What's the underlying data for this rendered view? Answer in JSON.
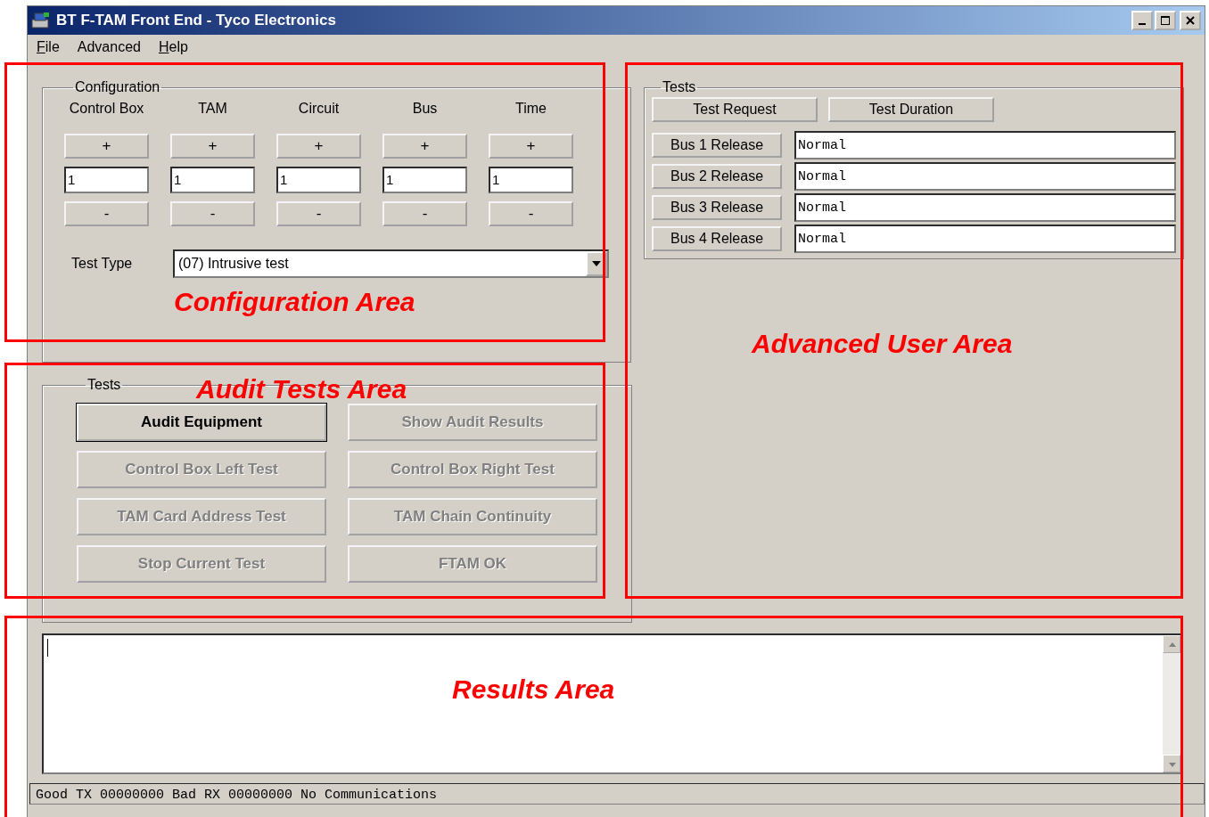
{
  "window": {
    "title": "BT F-TAM Front End - Tyco Electronics"
  },
  "menu": [
    {
      "label": "File",
      "underlined": true
    },
    {
      "label": "Advanced",
      "underlined": false
    },
    {
      "label": "Help",
      "underlined": true
    }
  ],
  "configuration": {
    "title": "Configuration",
    "columns": [
      {
        "label": "Control Box",
        "increment": "+",
        "value": "1",
        "decrement": "-"
      },
      {
        "label": "TAM",
        "increment": "+",
        "value": "1",
        "decrement": "-"
      },
      {
        "label": "Circuit",
        "increment": "+",
        "value": "1",
        "decrement": "-"
      },
      {
        "label": "Bus",
        "increment": "+",
        "value": "1",
        "decrement": "-"
      },
      {
        "label": "Time",
        "increment": "+",
        "value": "1",
        "decrement": "-"
      }
    ],
    "test_type": {
      "label": "Test Type",
      "value": "(07) Intrusive test"
    }
  },
  "audit_tests": {
    "title": "Tests",
    "buttons": [
      {
        "label": "Audit Equipment",
        "disabled": false,
        "default": true
      },
      {
        "label": "Show Audit Results",
        "disabled": true,
        "default": false
      },
      {
        "label": "Control Box Left Test",
        "disabled": true,
        "default": false
      },
      {
        "label": "Control Box Right Test",
        "disabled": true,
        "default": false
      },
      {
        "label": "TAM Card Address Test",
        "disabled": true,
        "default": false
      },
      {
        "label": "TAM Chain Continuity",
        "disabled": true,
        "default": false
      },
      {
        "label": "Stop Current Test",
        "disabled": true,
        "default": false
      },
      {
        "label": "FTAM OK",
        "disabled": true,
        "default": false
      }
    ]
  },
  "advanced": {
    "title": "Tests",
    "header_buttons": [
      "Test Request",
      "Test Duration"
    ],
    "bus_rows": [
      {
        "button": "Bus 1 Release",
        "value": "Normal"
      },
      {
        "button": "Bus 2 Release",
        "value": "Normal"
      },
      {
        "button": "Bus 3 Release",
        "value": "Normal"
      },
      {
        "button": "Bus 4 Release",
        "value": "Normal"
      }
    ]
  },
  "status_bar": {
    "text": "Good TX 00000000 Bad RX 00000000 No Communications"
  },
  "annotations": [
    {
      "label": "Configuration Area"
    },
    {
      "label": "Audit Tests Area"
    },
    {
      "label": "Advanced User Area"
    },
    {
      "label": "Results Area"
    }
  ]
}
